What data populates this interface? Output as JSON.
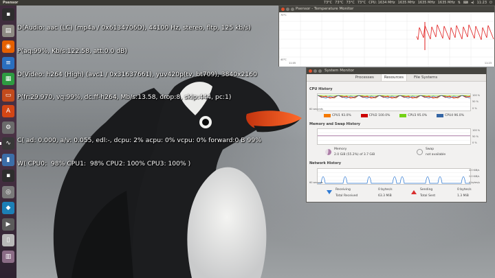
{
  "top_panel": {
    "app_title": "Psensor",
    "indicators": [
      "73°C",
      "73°C",
      "73°C",
      "73°C",
      "CPU: 1634 MHz",
      "1635 MHz",
      "1635 MHz",
      "1635 MHz"
    ],
    "clock": "11:23"
  },
  "launcher": {
    "items": [
      {
        "icon": "terminal-icon",
        "color": "#2d2d2d",
        "glyph": "▪"
      },
      {
        "icon": "files-icon",
        "color": "#8d8a83",
        "glyph": "▤"
      },
      {
        "icon": "firefox-icon",
        "color": "#e66000",
        "glyph": "◉"
      },
      {
        "icon": "writer-icon",
        "color": "#2a6fbf",
        "glyph": "≡"
      },
      {
        "icon": "calc-icon",
        "color": "#2e9b41",
        "glyph": "▦"
      },
      {
        "icon": "impress-icon",
        "color": "#c24a1c",
        "glyph": "▭"
      },
      {
        "icon": "software-center-icon",
        "color": "#d34615",
        "glyph": "A"
      },
      {
        "icon": "settings-icon",
        "color": "#6b6b6b",
        "glyph": "⚙"
      },
      {
        "icon": "system-monitor-icon",
        "color": "#383838",
        "glyph": "∿"
      },
      {
        "icon": "psensor-icon",
        "color": "#3c6ea8",
        "glyph": "▮"
      },
      {
        "icon": "terminal-icon-2",
        "color": "#2d2d2d",
        "glyph": "▪"
      },
      {
        "icon": "camera-icon",
        "color": "#7a7a7a",
        "glyph": "◎"
      },
      {
        "icon": "kodi-icon",
        "color": "#1c7fb6",
        "glyph": "◆"
      },
      {
        "icon": "media-icon",
        "color": "#5b5b5b",
        "glyph": "▶"
      },
      {
        "icon": "usb-drive-icon",
        "color": "#b8b8b8",
        "glyph": "▯"
      },
      {
        "icon": "trash-icon",
        "color": "#8b6c86",
        "glyph": "▥"
      }
    ]
  },
  "osd": {
    "lines_top": [
      "D(Audio: aac (LC) (mp4a / 0x6134706D), 44100 Hz, stereo, fltp, 125 kb/s)",
      "P(aq:99%, Kb/s:122.58, att:0.0 dB)",
      "D(Video: h264 (High) (avc1 / 0x31637661), yuv420p(tv, bt709), 3840x2160",
      "P(fr:29.970, vq:99%, dc:ff-h264, Mb/s:13.58, drop:8, skip:444, pc:1)"
    ],
    "lines_bottom": [
      "C( ad: 0.000, a/v: 0.055, edl:-, dcpu: 2% acpu: 0% vcpu: 0% forward:0 B 99%",
      "W( CPU0:  98% CPU1:  98% CPU2: 100% CPU3: 100% )"
    ]
  },
  "psensor": {
    "title": "Psensor - Temperature Monitor",
    "y_max": "70°C",
    "y_min": "40°C",
    "time_start": "11:05",
    "time_end": "11:23",
    "line_color": "#e01818"
  },
  "sysmon": {
    "title": "System Monitor",
    "tabs": [
      "Processes",
      "Resources",
      "File Systems"
    ],
    "active_tab": 1,
    "cpu": {
      "title": "CPU History",
      "x_start": "60 seconds",
      "y_labels": [
        "100 %",
        "50 %",
        "0 %"
      ],
      "legend": [
        {
          "label": "CPU1  93.0%",
          "color": "#f57900"
        },
        {
          "label": "CPU2  100.0%",
          "color": "#cc0000"
        },
        {
          "label": "CPU3  95.0%",
          "color": "#73d216"
        },
        {
          "label": "CPU4  96.0%",
          "color": "#3465a4"
        }
      ]
    },
    "memory": {
      "title": "Memory and Swap History",
      "y_labels": [
        "100 %",
        "50 %",
        "0 %"
      ],
      "memory_label": "Memory",
      "memory_value": "2.0 GiB (55.2%) of 3.7 GiB",
      "memory_color": "#ad7fa8",
      "swap_label": "Swap",
      "swap_value": "not available"
    },
    "network": {
      "title": "Network History",
      "x_start": "60 seconds",
      "y_labels": [
        "4.0 KiB/s",
        "2.0 KiB/s",
        "0 bytes/s"
      ],
      "receiving_label": "Receiving",
      "receiving_value": "0 bytes/s",
      "total_received_label": "Total Received",
      "total_received_value": "63.3 MiB",
      "sending_label": "Sending",
      "sending_value": "0 bytes/s",
      "total_sent_label": "Total Sent",
      "total_sent_value": "1.3 MiB"
    }
  }
}
